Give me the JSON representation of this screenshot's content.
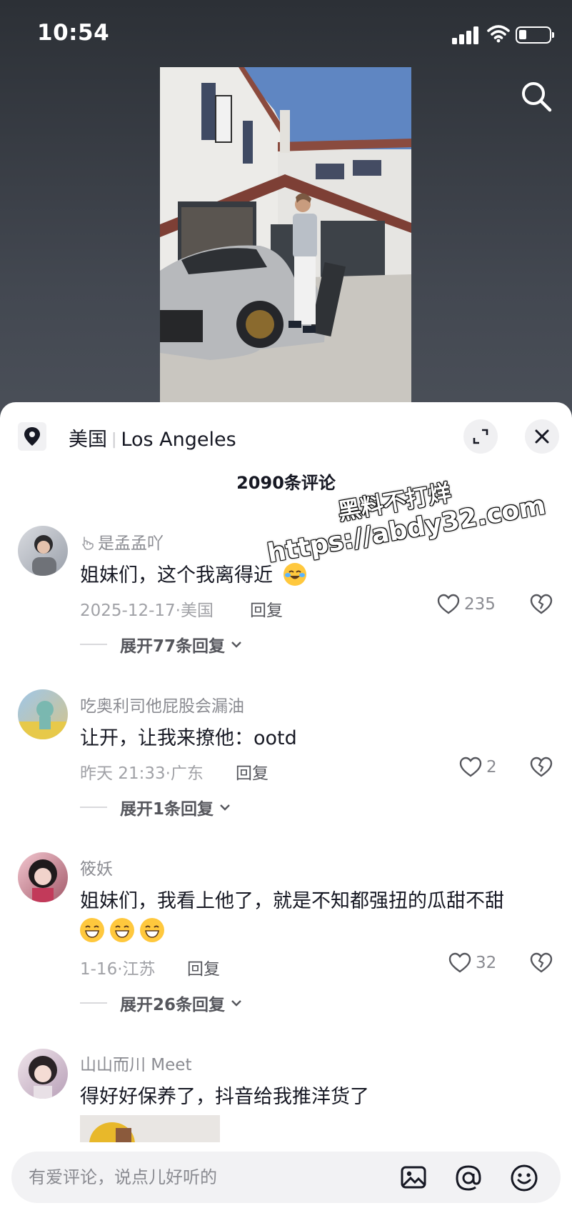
{
  "status_bar": {
    "time": "10:54"
  },
  "location": {
    "country": "美国",
    "city": "Los Angeles"
  },
  "comment_count": "2090条评论",
  "comments": [
    {
      "username": "是孟孟吖",
      "text": "姐妹们，这个我离得近",
      "date": "2025-12-17·美国",
      "reply_label": "回复",
      "likes": "235",
      "expand_label": "展开77条回复"
    },
    {
      "username": "吃奥利司他屁股会漏油",
      "text": "让开，让我来撩他：ootd",
      "date": "昨天 21:33·广东",
      "reply_label": "回复",
      "likes": "2",
      "expand_label": "展开1条回复"
    },
    {
      "username": "筱妖",
      "text": "姐妹们，我看上他了，就是不知都强扭的瓜甜不甜",
      "date": "1-16·江苏",
      "reply_label": "回复",
      "likes": "32",
      "expand_label": "展开26条回复"
    },
    {
      "username": "山山而川 Meet",
      "text": "得好好保养了，抖音给我推洋货了"
    }
  ],
  "watermark": {
    "line1": "黑料不打烊",
    "line2": "https://abdy32.com"
  },
  "input": {
    "placeholder": "有爱评论，说点儿好听的"
  },
  "icons": {
    "search": "search-icon",
    "location": "location-pin-icon",
    "expand": "expand-icon",
    "close": "close-icon",
    "like": "heart-icon",
    "dislike": "broken-heart-icon",
    "image": "image-icon",
    "mention": "at-icon",
    "emoji": "emoji-icon"
  },
  "colors": {
    "sheet_bg": "#ffffff",
    "text_primary": "#161823",
    "text_secondary": "#8a8b91"
  }
}
